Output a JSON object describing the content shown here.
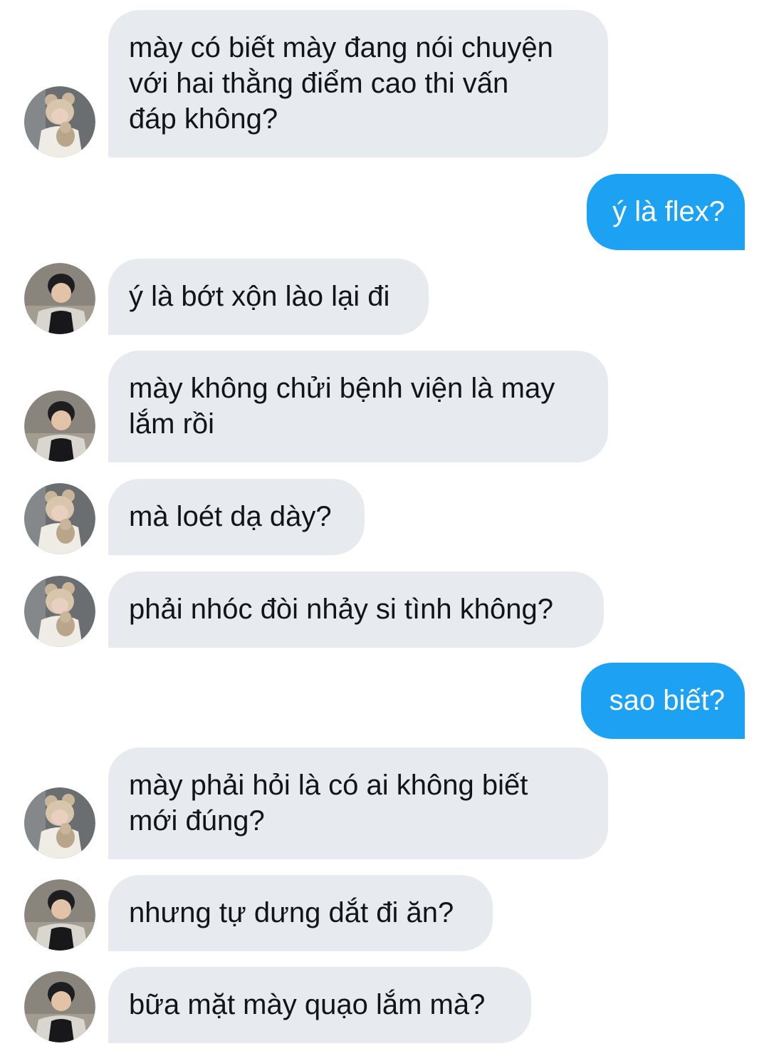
{
  "conversation": {
    "colors": {
      "incoming_bubble": "#e7ebef",
      "outgoing_bubble": "#1da1f2",
      "incoming_text": "#111418",
      "outgoing_text": "#ffffff"
    },
    "messages": [
      {
        "sender": "contact_a",
        "direction": "incoming",
        "text": "mày có biết mày đang nói chuyện\nvới hai thằng điểm cao thi vấn\nđáp không?"
      },
      {
        "sender": "me",
        "direction": "outgoing",
        "text": "ý là flex?"
      },
      {
        "sender": "contact_b",
        "direction": "incoming",
        "text": "ý là bớt xộn lào lại đi"
      },
      {
        "sender": "contact_b",
        "direction": "incoming",
        "text": "mày không chửi bệnh viện là may\nlắm rồi"
      },
      {
        "sender": "contact_a",
        "direction": "incoming",
        "text": "mà loét dạ dày?"
      },
      {
        "sender": "contact_a",
        "direction": "incoming",
        "text": "phải nhóc đòi nhảy si tình không?"
      },
      {
        "sender": "me",
        "direction": "outgoing",
        "text": "sao biết?"
      },
      {
        "sender": "contact_a",
        "direction": "incoming",
        "text": "mày phải hỏi là có ai không biết\nmới đúng?"
      },
      {
        "sender": "contact_b",
        "direction": "incoming",
        "text": "nhưng tự dưng dắt đi ăn?"
      },
      {
        "sender": "contact_b",
        "direction": "incoming",
        "text": "bữa mặt mày quạo lắm mà?"
      }
    ]
  }
}
